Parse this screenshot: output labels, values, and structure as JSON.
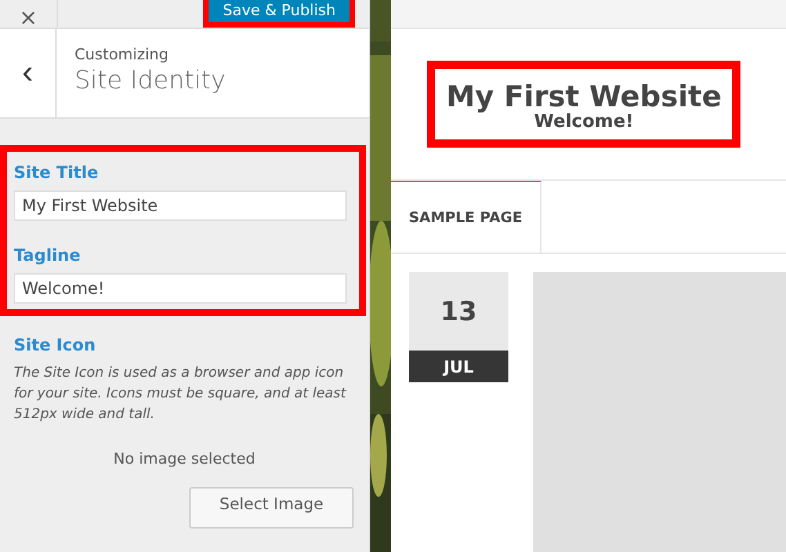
{
  "customizer": {
    "close": "×",
    "publish_button": "Save & Publish",
    "back": "‹",
    "breadcrumb": "Customizing",
    "panel_title": "Site Identity",
    "fields": [
      {
        "label": "Site Title",
        "value": "My First Website"
      },
      {
        "label": "Tagline",
        "value": "Welcome!"
      }
    ],
    "site_icon": {
      "label": "Site Icon",
      "description": "The Site Icon is used as a browser and app icon for your site. Icons must be square, and at least 512px wide and tall.",
      "status": "No image selected",
      "button": "Select Image"
    }
  },
  "preview": {
    "site_title": "My First Website",
    "tagline": "Welcome!",
    "menu": [
      {
        "label": "SAMPLE PAGE",
        "selected": true
      }
    ],
    "post": {
      "day": "13",
      "month": "JUL",
      "image": {
        "kind": "placeholder"
      }
    }
  }
}
